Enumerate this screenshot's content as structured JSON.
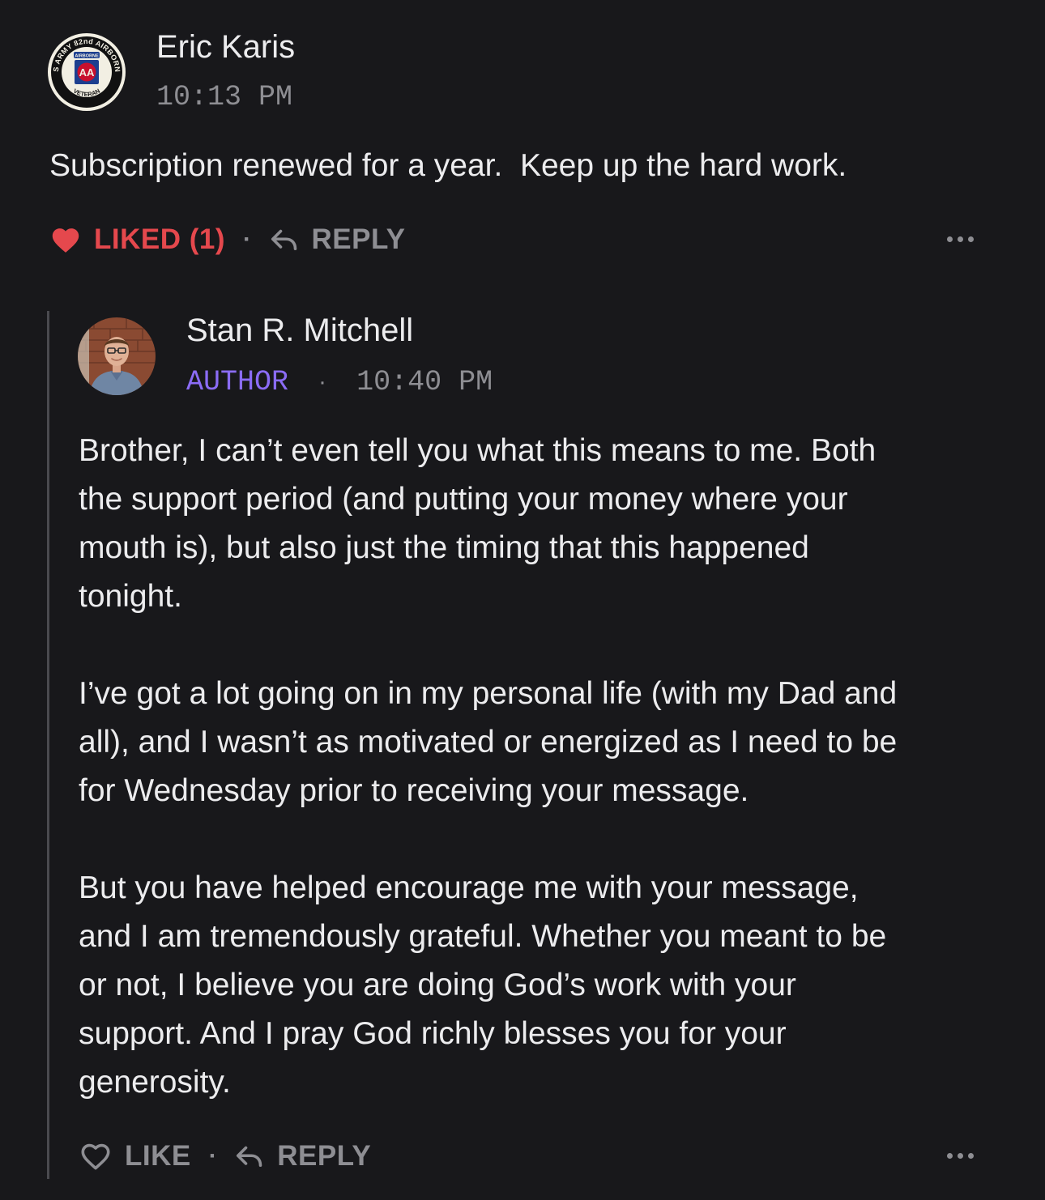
{
  "comment": {
    "author": "Eric Karis",
    "time": "10:13 PM",
    "avatar_icon": "82nd-airborne-veteran-badge-icon",
    "avatar_badge": {
      "top_text": "US ARMY 82nd AIRBORNE",
      "bottom_text": "VETERAN",
      "tab_text": "AIRBORNE",
      "center": "AA"
    },
    "body": "Subscription renewed for a year.  Keep up the hard work.",
    "like_label": "LIKED (1)",
    "like_color": "#e5484d",
    "reply_label": "REPLY"
  },
  "reply": {
    "author": "Stan R. Mitchell",
    "role": "AUTHOR",
    "role_color": "#8b6cf6",
    "time": "10:40 PM",
    "paragraphs": [
      "Brother, I can’t even tell you what this means to me. Both\nthe support period (and putting your money where your\nmouth is), but also just the timing that this happened\ntonight.",
      "I’ve got a lot going on in my personal life (with my Dad and\nall), and I wasn’t as motivated or energized as I need to be\nfor Wednesday prior to receiving your message.",
      "But you have helped encourage me with your message,\nand I am tremendously grateful. Whether you meant to be\nor not, I believe you are doing God’s work with your\nsupport. And I pray God richly blesses you for your\ngenerosity."
    ],
    "like_label": "LIKE",
    "reply_label": "REPLY"
  },
  "colors": {
    "background": "#18181b",
    "text": "#ececee",
    "muted": "#8e8e93"
  }
}
